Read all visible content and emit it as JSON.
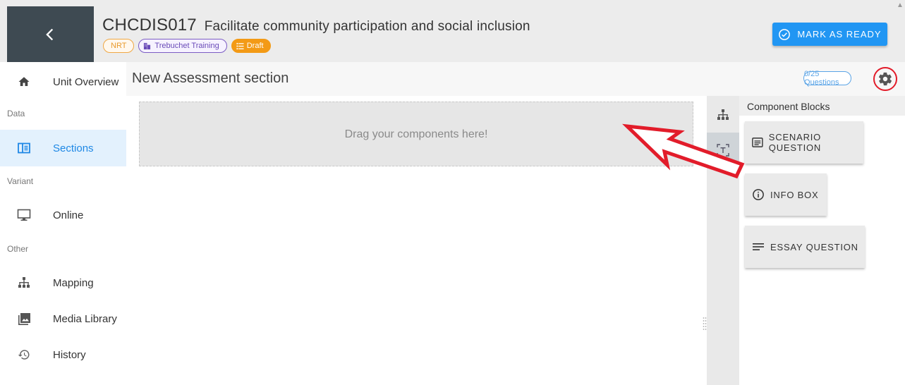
{
  "header": {
    "unit_code": "CHCDIS017",
    "unit_name": "Facilitate community participation and social inclusion",
    "chips": {
      "nrt": "NRT",
      "org": "Trebuchet Training",
      "status": "Draft"
    },
    "mark_ready_label": "MARK AS READY",
    "colors": {
      "back_bg": "#3e4a52",
      "primary": "#2196f3",
      "draft": "#f39a16",
      "nrt": "#e89a2d",
      "org": "#6a4bb8"
    }
  },
  "sidebar": {
    "overview": {
      "label": "Unit Overview",
      "icon": "home-icon"
    },
    "group_data": "Data",
    "sections": {
      "label": "Sections",
      "icon": "view-sections-icon"
    },
    "group_variant": "Variant",
    "online": {
      "label": "Online",
      "icon": "monitor-icon"
    },
    "group_other": "Other",
    "mapping": {
      "label": "Mapping",
      "icon": "sitemap-icon"
    },
    "media": {
      "label": "Media Library",
      "icon": "image-library-icon"
    },
    "history": {
      "label": "History",
      "icon": "history-icon"
    }
  },
  "section": {
    "title": "New Assessment section",
    "question_count": "0/25 Questions",
    "settings_icon": "gear-icon"
  },
  "dropzone": {
    "text": "Drag your components here!"
  },
  "panel": {
    "title": "Component Blocks",
    "blocks": [
      {
        "label": "SCENARIO QUESTION",
        "icon": "scenario-icon"
      },
      {
        "label": "INFO BOX",
        "icon": "info-icon"
      },
      {
        "label": "ESSAY QUESTION",
        "icon": "lines-icon"
      }
    ]
  },
  "annotation": {
    "arrow_color": "#e21c2a"
  }
}
